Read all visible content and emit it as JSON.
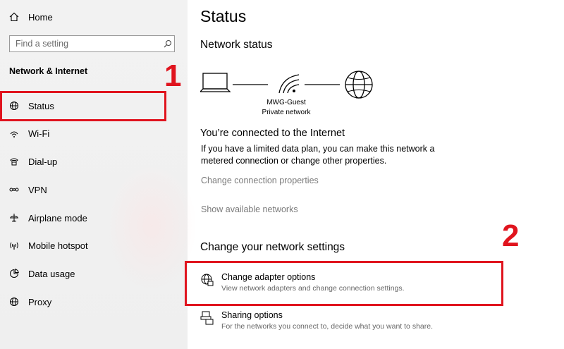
{
  "sidebar": {
    "home_label": "Home",
    "search_placeholder": "Find a setting",
    "section_title": "Network & Internet",
    "items": [
      {
        "label": "Status",
        "icon": "globe-icon"
      },
      {
        "label": "Wi-Fi",
        "icon": "wifi-icon"
      },
      {
        "label": "Dial-up",
        "icon": "phone-icon"
      },
      {
        "label": "VPN",
        "icon": "vpn-icon"
      },
      {
        "label": "Airplane mode",
        "icon": "airplane-icon"
      },
      {
        "label": "Mobile hotspot",
        "icon": "hotspot-icon"
      },
      {
        "label": "Data usage",
        "icon": "data-usage-icon"
      },
      {
        "label": "Proxy",
        "icon": "globe-icon"
      }
    ]
  },
  "main": {
    "title": "Status",
    "network_status_heading": "Network status",
    "network_name": "MWG-Guest",
    "network_type": "Private network",
    "connected_heading": "You’re connected to the Internet",
    "connected_desc_1": "If you have a limited data plan, you can make this network a",
    "connected_desc_2": "metered connection or change other properties.",
    "change_connection_properties": "Change connection properties",
    "show_available_networks": "Show available networks",
    "change_settings_heading": "Change your network settings",
    "options": [
      {
        "title": "Change adapter options",
        "subtitle": "View network adapters and change connection settings."
      },
      {
        "title": "Sharing options",
        "subtitle": "For the networks you connect to, decide what you want to share."
      }
    ]
  },
  "annotations": {
    "step1": "1",
    "step2": "2",
    "color": "#e0141e"
  }
}
